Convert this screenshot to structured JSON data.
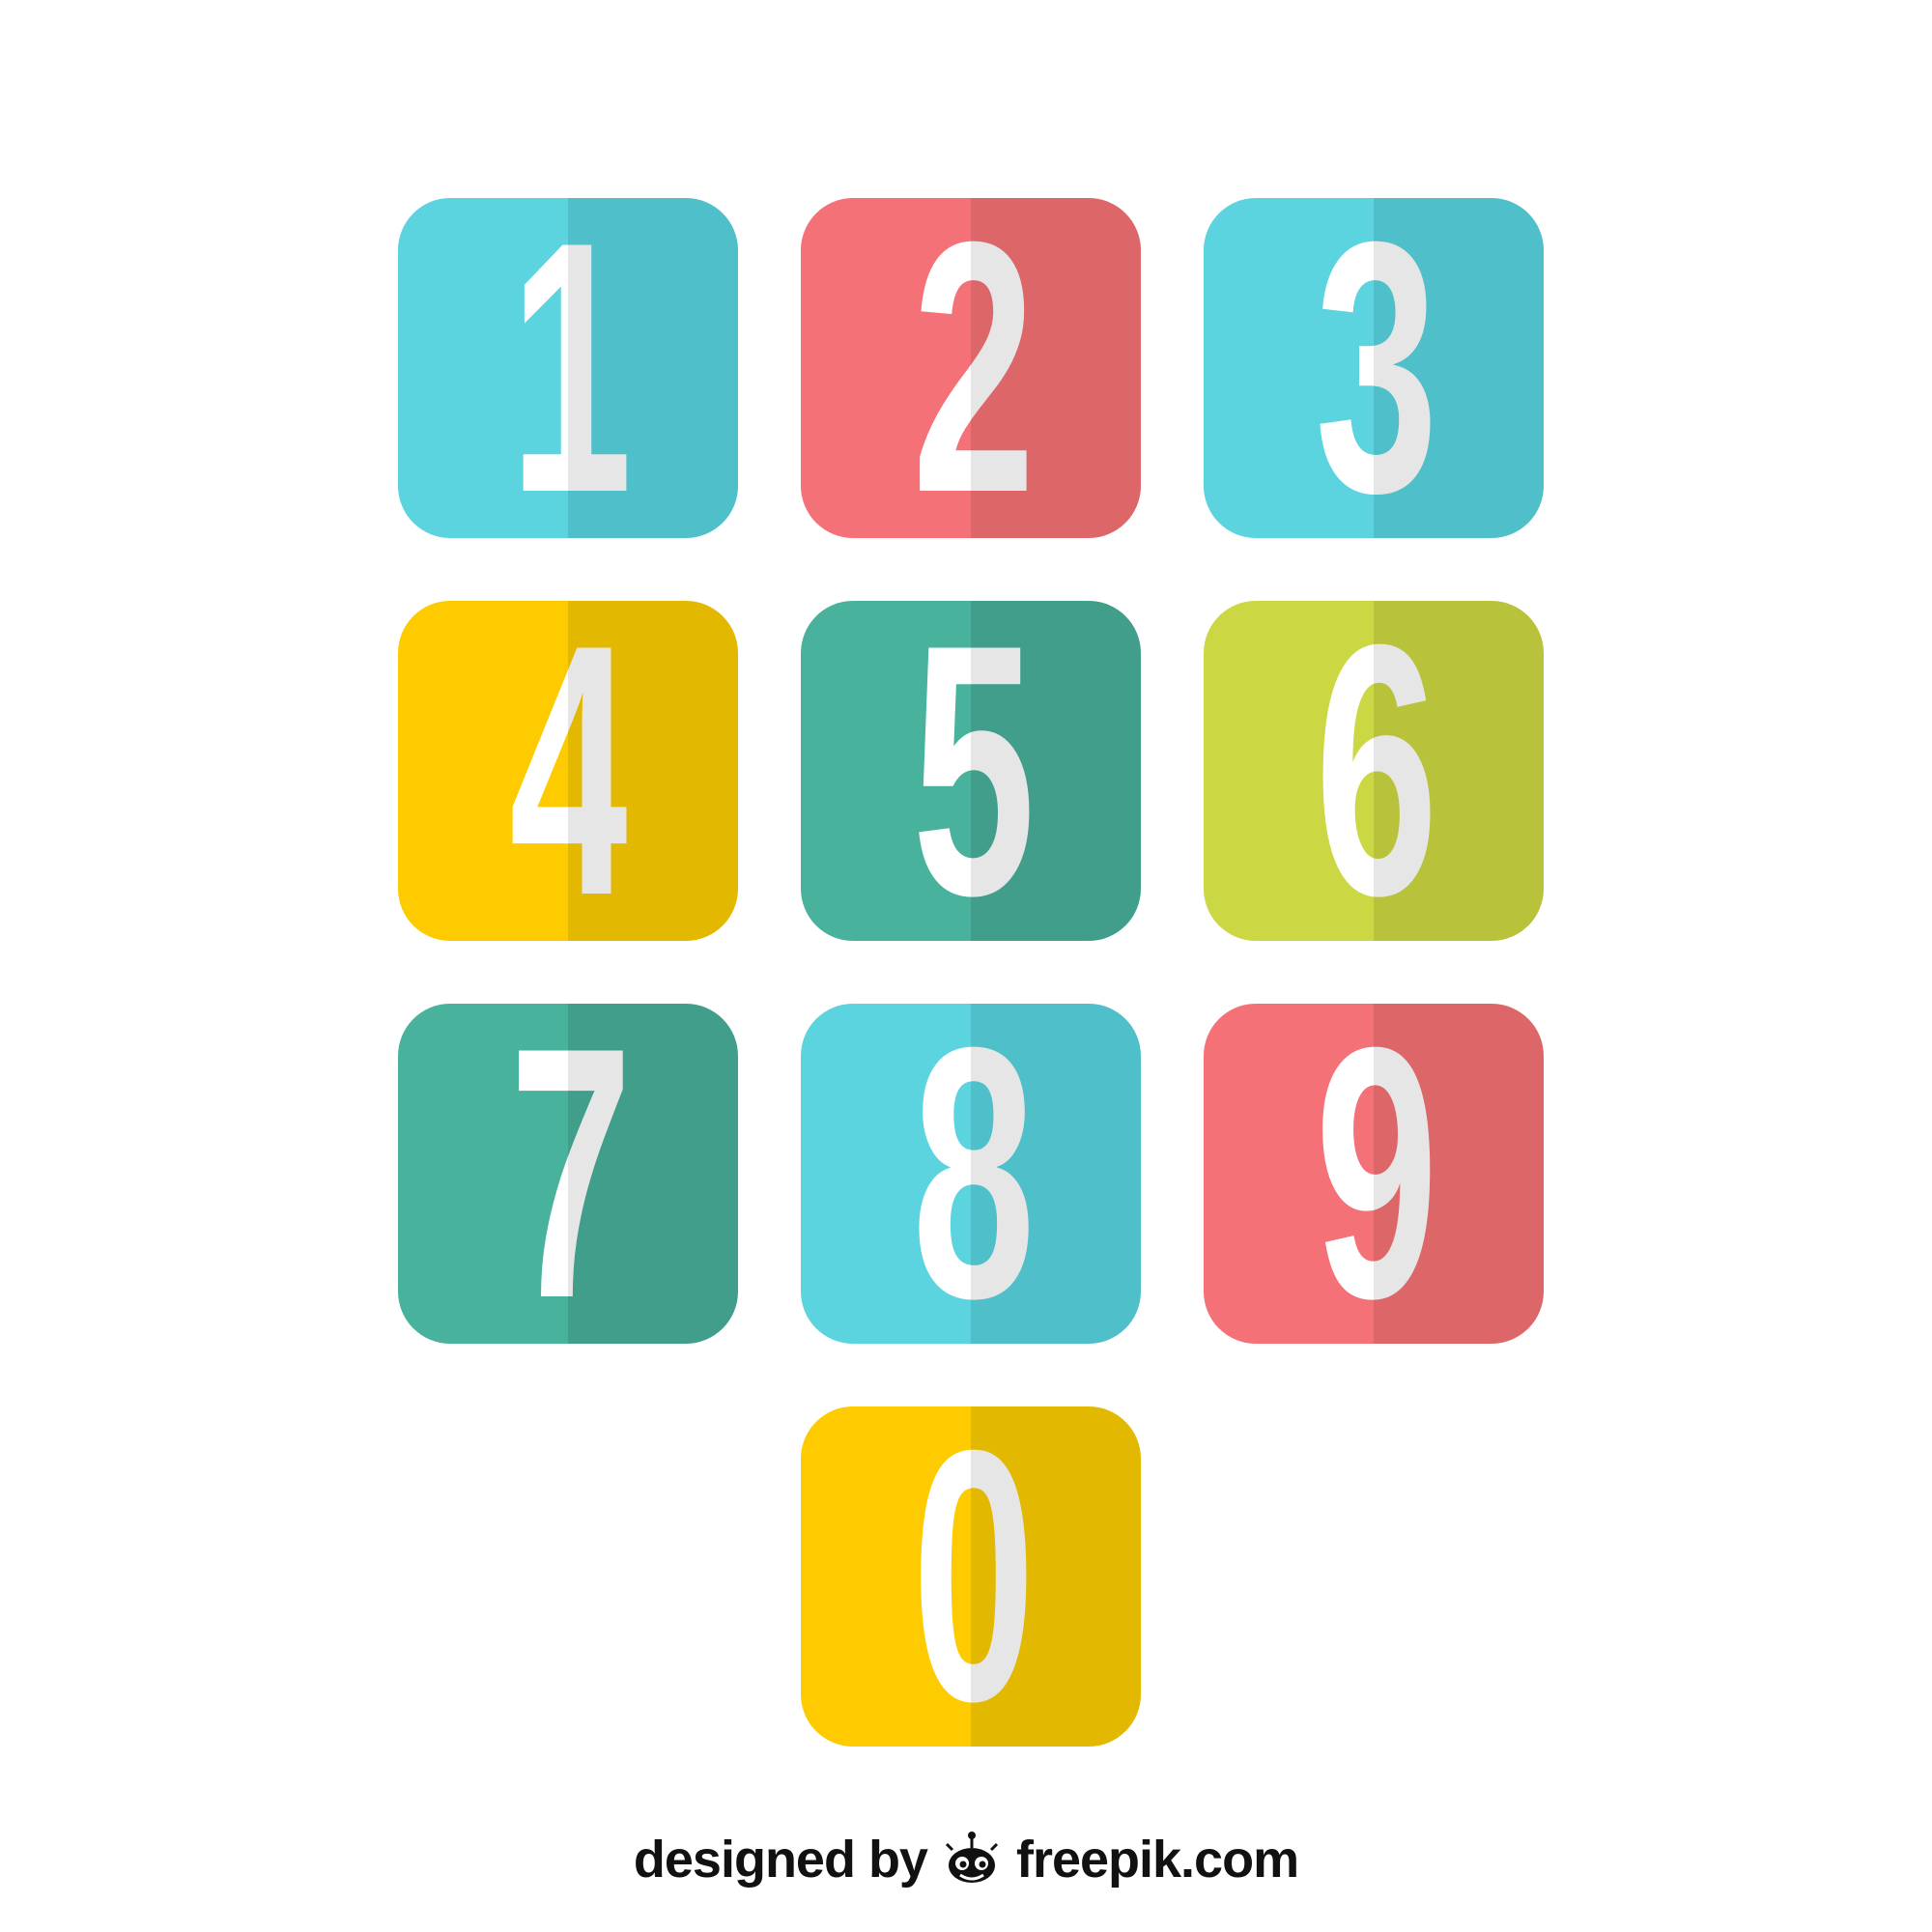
{
  "tiles": [
    {
      "digit": "1",
      "left_color": "#5bd4df",
      "right_color": "#4fbfc9"
    },
    {
      "digit": "2",
      "left_color": "#f47277",
      "right_color": "#dd6669"
    },
    {
      "digit": "3",
      "left_color": "#5bd4df",
      "right_color": "#4fbfc9"
    },
    {
      "digit": "4",
      "left_color": "#fecb00",
      "right_color": "#e3b800"
    },
    {
      "digit": "5",
      "left_color": "#49b29d",
      "right_color": "#409e8b"
    },
    {
      "digit": "6",
      "left_color": "#ccd843",
      "right_color": "#b8c23b"
    },
    {
      "digit": "7",
      "left_color": "#49b29d",
      "right_color": "#409e8b"
    },
    {
      "digit": "8",
      "left_color": "#5bd4df",
      "right_color": "#4fbfc9"
    },
    {
      "digit": "9",
      "left_color": "#f47277",
      "right_color": "#dd6669"
    },
    {
      "digit": "0",
      "left_color": "#fecb00",
      "right_color": "#e3b800"
    }
  ],
  "footer": {
    "prefix": "designed by",
    "logo_icon": "freepik-logo-icon",
    "brand": "freepik.com"
  }
}
